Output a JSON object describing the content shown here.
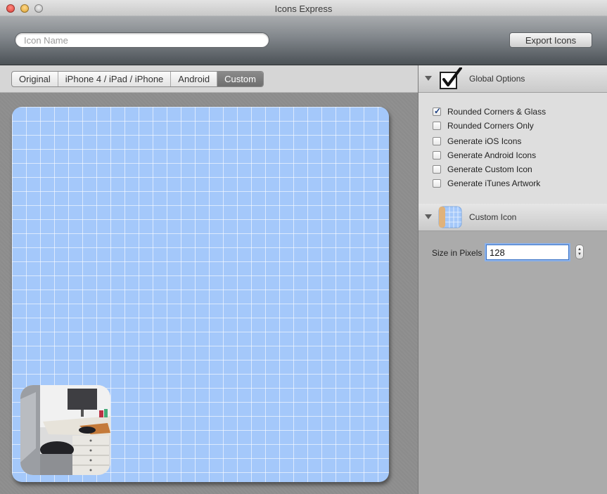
{
  "window": {
    "title": "Icons Express"
  },
  "toolbar": {
    "search_placeholder": "Icon Name",
    "export_label": "Export Icons"
  },
  "tabs": [
    {
      "label": "Original",
      "active": false
    },
    {
      "label": "iPhone 4 / iPad / iPhone",
      "active": false
    },
    {
      "label": "Android",
      "active": false
    },
    {
      "label": "Custom",
      "active": true
    }
  ],
  "global_options": {
    "title": "Global Options",
    "options": [
      {
        "label": "Rounded Corners & Glass",
        "checked": true
      },
      {
        "label": "Rounded Corners Only",
        "checked": false
      },
      {
        "label": "Generate iOS Icons",
        "checked": false
      },
      {
        "label": "Generate Android Icons",
        "checked": false
      },
      {
        "label": "Generate Custom Icon",
        "checked": false
      },
      {
        "label": "Generate iTunes Artwork",
        "checked": false
      }
    ]
  },
  "custom_icon": {
    "title": "Custom Icon",
    "size_label": "Size in Pixels",
    "size_value": "128"
  },
  "colors": {
    "grid_background": "#a4c8fa",
    "active_tab": "#7d7d7d",
    "focus_ring": "#8ab1ea"
  }
}
